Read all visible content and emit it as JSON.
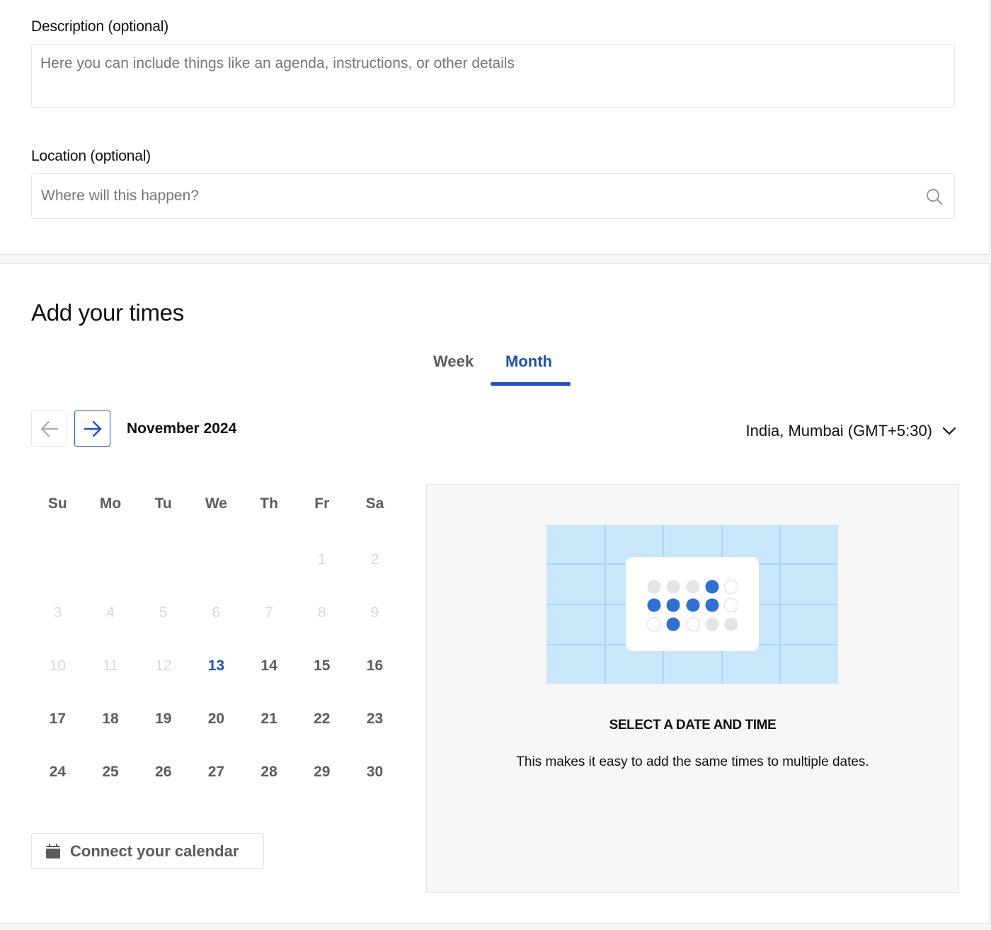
{
  "details": {
    "description": {
      "label": "Description (optional)",
      "placeholder": "Here you can include things like an agenda, instructions, or other details",
      "value": ""
    },
    "location": {
      "label": "Location (optional)",
      "placeholder": "Where will this happen?",
      "value": "",
      "icon": "search-icon"
    }
  },
  "times": {
    "title": "Add your times",
    "tabs": [
      {
        "label": "Week",
        "active": false
      },
      {
        "label": "Month",
        "active": true
      }
    ],
    "nav": {
      "prev_icon": "arrow-left-icon",
      "next_icon": "arrow-right-icon",
      "prev_enabled": false,
      "next_enabled": true
    },
    "month_label": "November 2024",
    "timezone": {
      "label": "India, Mumbai (GMT+5:30)",
      "icon": "chevron-down-icon"
    },
    "calendar": {
      "weekdays": [
        "Su",
        "Mo",
        "Tu",
        "We",
        "Th",
        "Fr",
        "Sa"
      ],
      "weeks": [
        [
          null,
          null,
          null,
          null,
          null,
          {
            "d": "1",
            "s": "disabled"
          },
          {
            "d": "2",
            "s": "disabled"
          }
        ],
        [
          {
            "d": "3",
            "s": "disabled"
          },
          {
            "d": "4",
            "s": "disabled"
          },
          {
            "d": "5",
            "s": "disabled"
          },
          {
            "d": "6",
            "s": "disabled"
          },
          {
            "d": "7",
            "s": "disabled"
          },
          {
            "d": "8",
            "s": "disabled"
          },
          {
            "d": "9",
            "s": "disabled"
          }
        ],
        [
          {
            "d": "10",
            "s": "disabled"
          },
          {
            "d": "11",
            "s": "disabled"
          },
          {
            "d": "12",
            "s": "disabled"
          },
          {
            "d": "13",
            "s": "today"
          },
          {
            "d": "14",
            "s": "enabled"
          },
          {
            "d": "15",
            "s": "enabled"
          },
          {
            "d": "16",
            "s": "enabled"
          }
        ],
        [
          {
            "d": "17",
            "s": "enabled"
          },
          {
            "d": "18",
            "s": "enabled"
          },
          {
            "d": "19",
            "s": "enabled"
          },
          {
            "d": "20",
            "s": "enabled"
          },
          {
            "d": "21",
            "s": "enabled"
          },
          {
            "d": "22",
            "s": "enabled"
          },
          {
            "d": "23",
            "s": "enabled"
          }
        ],
        [
          {
            "d": "24",
            "s": "enabled"
          },
          {
            "d": "25",
            "s": "enabled"
          },
          {
            "d": "26",
            "s": "enabled"
          },
          {
            "d": "27",
            "s": "enabled"
          },
          {
            "d": "28",
            "s": "enabled"
          },
          {
            "d": "29",
            "s": "enabled"
          },
          {
            "d": "30",
            "s": "enabled"
          }
        ]
      ]
    },
    "connect_calendar": {
      "label": "Connect your calendar",
      "icon": "calendar-icon"
    },
    "empty_panel": {
      "title": "SELECT A DATE AND TIME",
      "text": "This makes it easy to add the same times to multiple dates.",
      "illustration": {
        "dot_grid": [
          [
            "gray",
            "gray",
            "gray",
            "blue",
            "empty"
          ],
          [
            "blue",
            "blue",
            "blue",
            "blue",
            "empty"
          ],
          [
            "empty",
            "blue",
            "empty",
            "gray",
            "gray"
          ]
        ]
      }
    }
  },
  "colors": {
    "accent": "#1f4fbf",
    "dot_blue": "#3070d2",
    "dot_gray": "#e4e4e4",
    "illustration_bg": "#c9e6fb",
    "illustration_grid": "#9fd0f7",
    "text_muted": "#5c5c5c",
    "text_disabled": "#d8d8d8",
    "page_bg": "#f5f6f8",
    "panel_bg": "#f7f7f7"
  }
}
